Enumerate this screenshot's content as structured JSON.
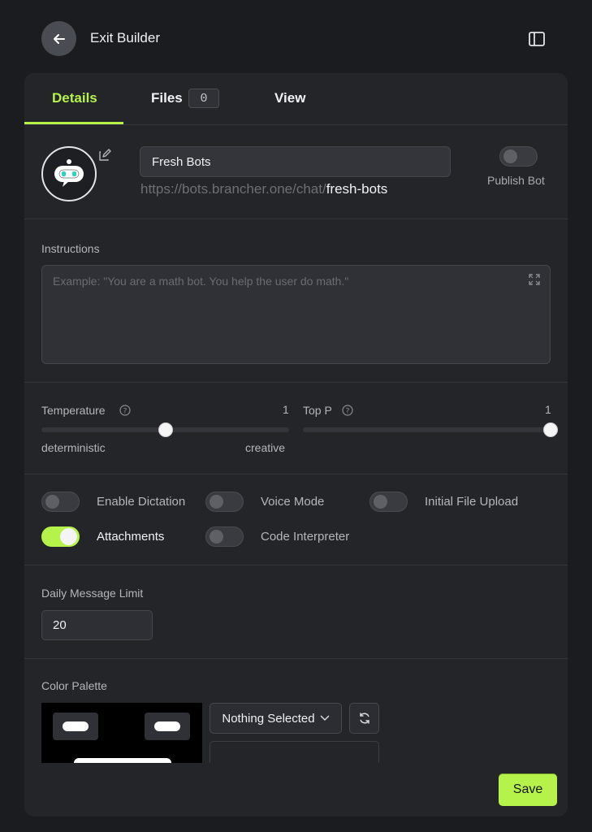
{
  "header": {
    "exit_label": "Exit Builder"
  },
  "tabs": [
    {
      "label": "Details",
      "active": true
    },
    {
      "label": "Files",
      "count": "0"
    },
    {
      "label": "View"
    }
  ],
  "bot": {
    "name": "Fresh Bots",
    "url_base": "https://bots.brancher.one/chat/",
    "url_slug": "fresh-bots",
    "publish_label": "Publish Bot",
    "publish_on": false
  },
  "instructions": {
    "label": "Instructions",
    "placeholder": "Example: \"You are a math bot. You help the user do math.\"",
    "value": ""
  },
  "sliders": {
    "temperature": {
      "label": "Temperature",
      "value": "1",
      "min_label": "deterministic",
      "max_label": "creative",
      "level": 0.5
    },
    "top_p": {
      "label": "Top P",
      "value": "1",
      "level": 1.0
    }
  },
  "toggles": [
    {
      "label": "Enable Dictation",
      "on": false
    },
    {
      "label": "Voice Mode",
      "on": false
    },
    {
      "label": "Initial File Upload",
      "on": false
    },
    {
      "label": "Attachments",
      "on": true
    },
    {
      "label": "Code Interpreter",
      "on": false
    }
  ],
  "daily_limit": {
    "label": "Daily Message Limit",
    "value": "20"
  },
  "palette": {
    "label": "Color Palette",
    "select_label": "Nothing Selected"
  },
  "save_label": "Save",
  "colors": {
    "accent": "#b5f24a",
    "background": "#1b1c20",
    "card": "#242529"
  },
  "icons": [
    "arrow-left-icon",
    "sidebar-panel-icon",
    "bot-avatar-icon",
    "edit-icon",
    "expand-icon",
    "help-icon",
    "chevron-down-icon",
    "refresh-icon"
  ]
}
